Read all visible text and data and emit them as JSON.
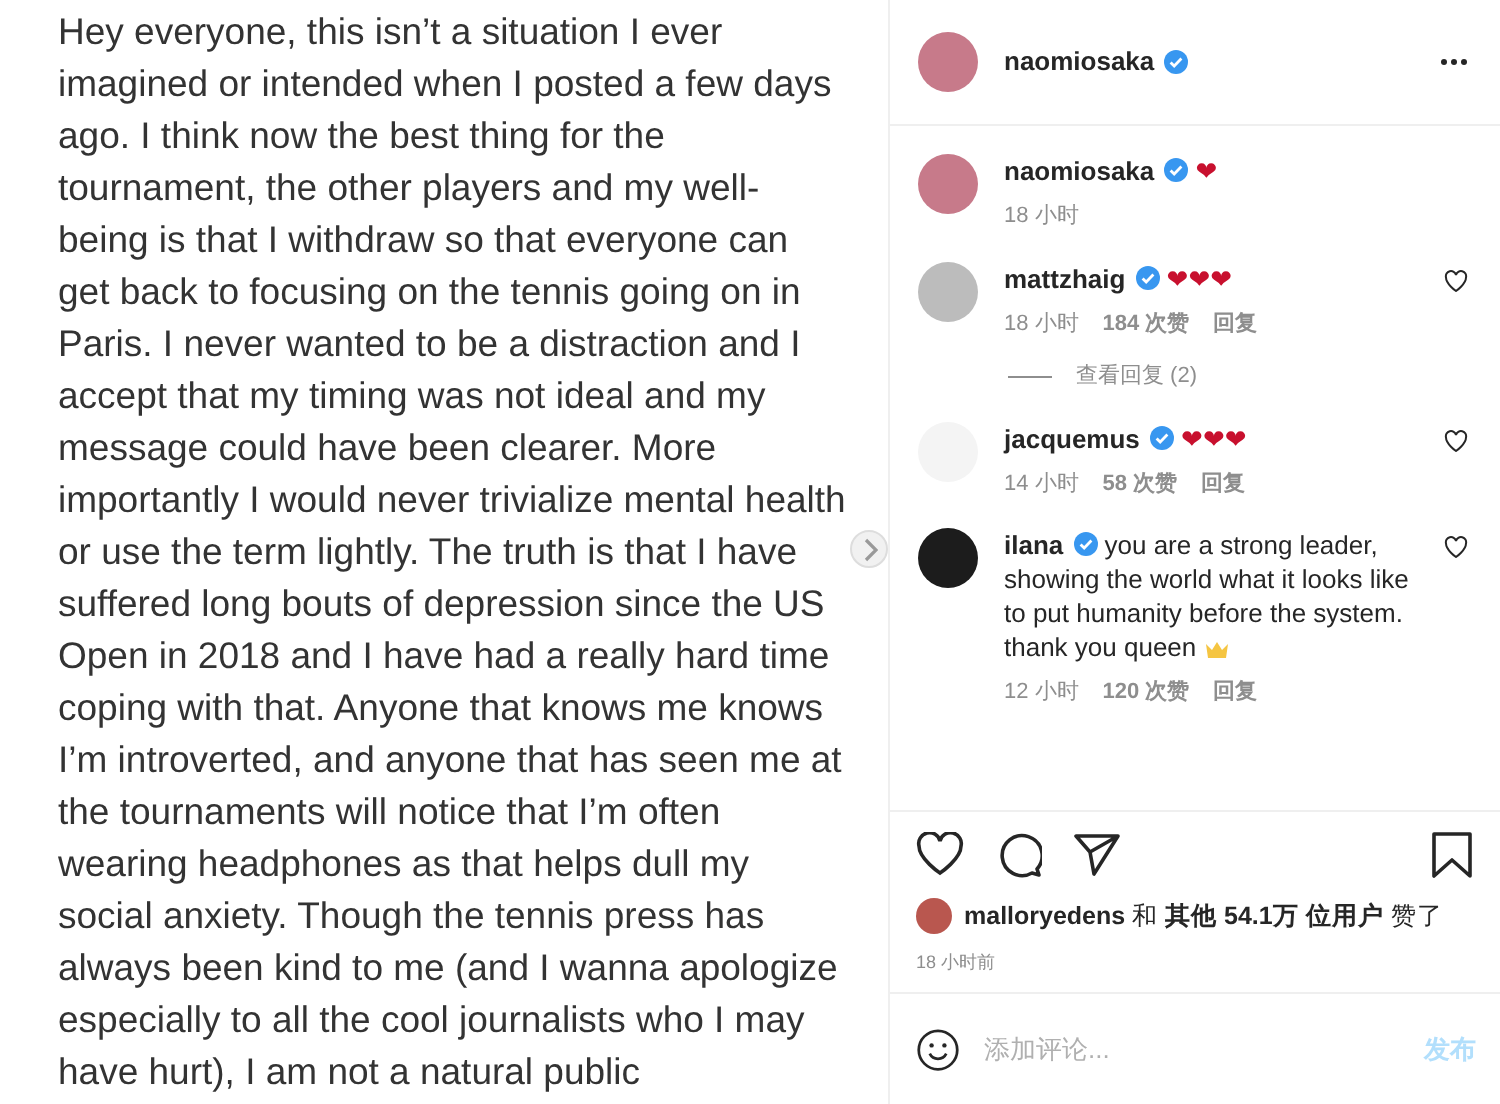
{
  "post_image": {
    "text": "Hey everyone, this isn’t a situation I ever imagined or intended when I posted a few days ago. I think now the best thing for the tournament, the other players and my well-being is that I withdraw so that everyone can get back to focusing on the tennis going on in Paris. I never wanted to be a distraction and I accept that my timing was not ideal and my message could have been clearer. More importantly I would never trivialize mental health or use the term lightly. The truth is that I have suffered long bouts of depression since the US Open in 2018 and I have had a really hard time coping with that. Anyone that knows me knows I’m introverted, and anyone that has seen me at the tournaments will notice that I’m often wearing headphones as that helps dull my social anxiety. Though the tennis press has always been kind to me (and I wanna apologize especially to all the cool journalists who I may have hurt), I am not a natural public"
  },
  "header": {
    "username": "naomiosaka"
  },
  "comments": [
    {
      "kind": "caption",
      "username": "naomiosaka",
      "text": "❤",
      "time": "18 小时"
    },
    {
      "kind": "comment",
      "username": "mattzhaig",
      "text": "❤❤❤",
      "time": "18 小时",
      "likes": "184 次赞",
      "reply": "回复",
      "liked": false,
      "view_replies": "查看回复 (2)"
    },
    {
      "kind": "comment",
      "username": "jacquemus",
      "text": "❤❤❤",
      "time": "14 小时",
      "likes": "58 次赞",
      "reply": "回复",
      "liked": false
    },
    {
      "kind": "comment",
      "username": "ilana",
      "text": "you are a strong leader, showing the world what it looks like to put humanity before the system. thank you queen",
      "crown": true,
      "time": "12 小时",
      "likes": "120 次赞",
      "reply": "回复",
      "liked": false
    }
  ],
  "likes_summary": "**malloryedens** 和 **其他 54.1万 位用户** 赞了",
  "post_time": "18 小时前",
  "comment_input": {
    "placeholder": "添加评论...",
    "post_button": "发布",
    "disabled": true
  }
}
